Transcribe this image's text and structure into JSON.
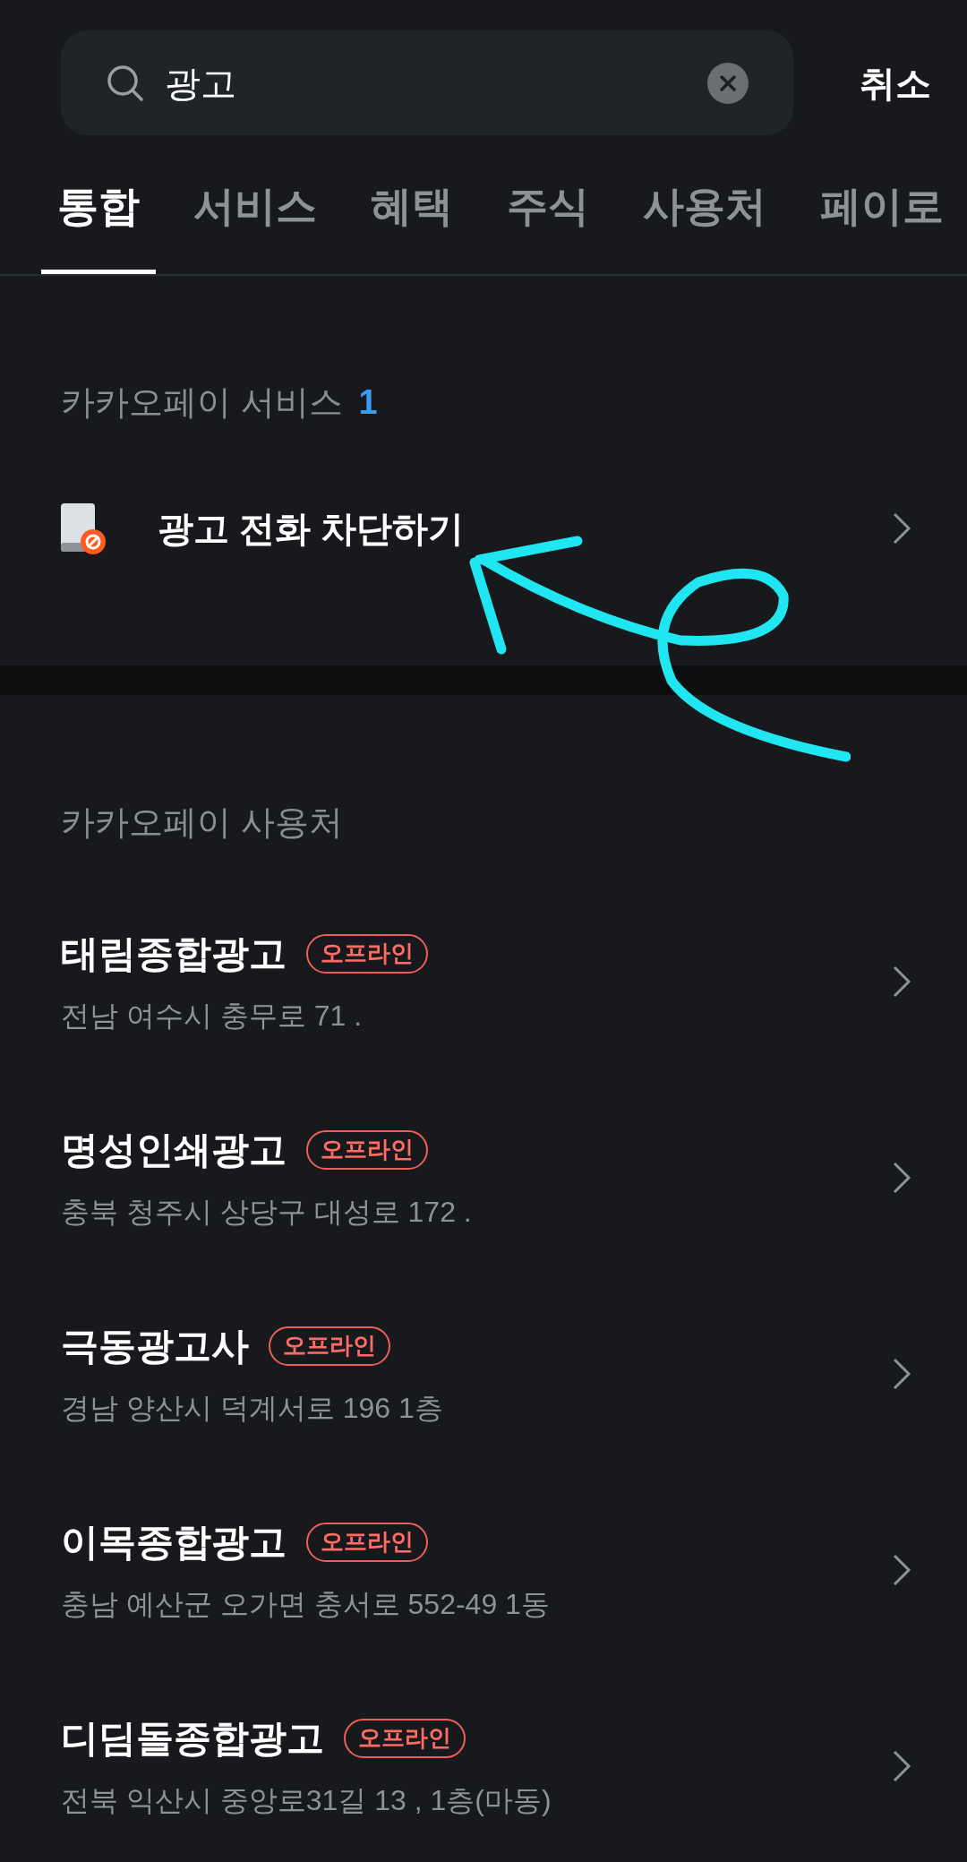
{
  "search": {
    "value": "광고",
    "cancel": "취소"
  },
  "tabs": [
    {
      "label": "통합",
      "selected": true
    },
    {
      "label": "서비스",
      "selected": false
    },
    {
      "label": "혜택",
      "selected": false
    },
    {
      "label": "주식",
      "selected": false
    },
    {
      "label": "사용처",
      "selected": false
    },
    {
      "label": "페이로",
      "selected": false
    }
  ],
  "services": {
    "title": "카카오페이 서비스",
    "count": "1",
    "items": [
      {
        "label": "광고 전화 차단하기"
      }
    ]
  },
  "places": {
    "title": "카카오페이 사용처",
    "items": [
      {
        "name": "태림종합광고",
        "badge": "오프라인",
        "address": "전남 여수시 충무로 71 ."
      },
      {
        "name": "명성인쇄광고",
        "badge": "오프라인",
        "address": "충북 청주시 상당구 대성로 172 ."
      },
      {
        "name": "극동광고사",
        "badge": "오프라인",
        "address": "경남 양산시 덕계서로 196 1층"
      },
      {
        "name": "이목종합광고",
        "badge": "오프라인",
        "address": "충남 예산군 오가면 충서로 552-49 1동"
      },
      {
        "name": "디딤돌종합광고",
        "badge": "오프라인",
        "address": "전북 익산시 중앙로31길 13 , 1층(마동)"
      }
    ]
  }
}
